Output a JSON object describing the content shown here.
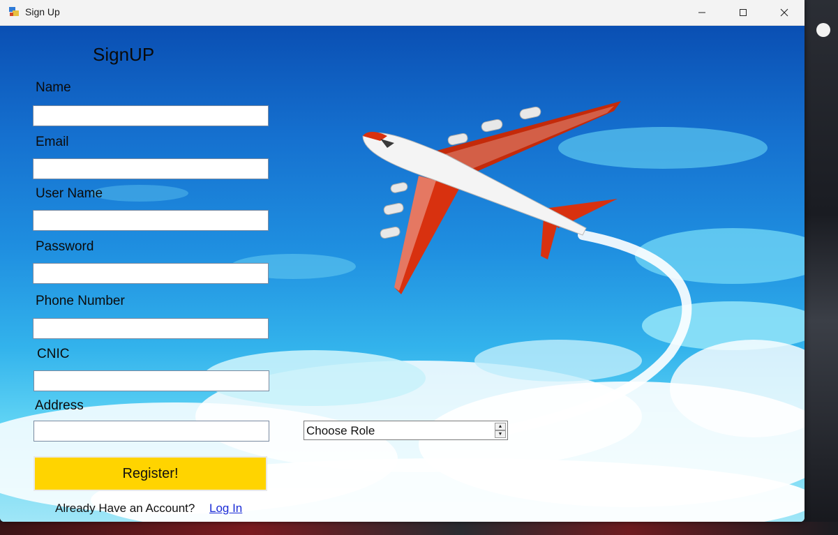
{
  "window": {
    "title": "Sign Up",
    "controls": [
      "minimize",
      "maximize",
      "close"
    ]
  },
  "form": {
    "heading": "SignUP",
    "fields": [
      {
        "label": "Name",
        "value": ""
      },
      {
        "label": "Email",
        "value": ""
      },
      {
        "label": "User Name",
        "value": ""
      },
      {
        "label": "Password",
        "value": ""
      },
      {
        "label": "Phone Number",
        "value": ""
      },
      {
        "label": "CNIC",
        "value": ""
      },
      {
        "label": "Address",
        "value": ""
      }
    ],
    "role_select": {
      "value": "Choose Role"
    },
    "register_label": "Register!",
    "account_prompt": "Already Have an Account?",
    "login_link": "Log In"
  },
  "colors": {
    "register_button": "#ffd400",
    "link": "#1a2bd6",
    "plane_accent": "#d8310f"
  }
}
